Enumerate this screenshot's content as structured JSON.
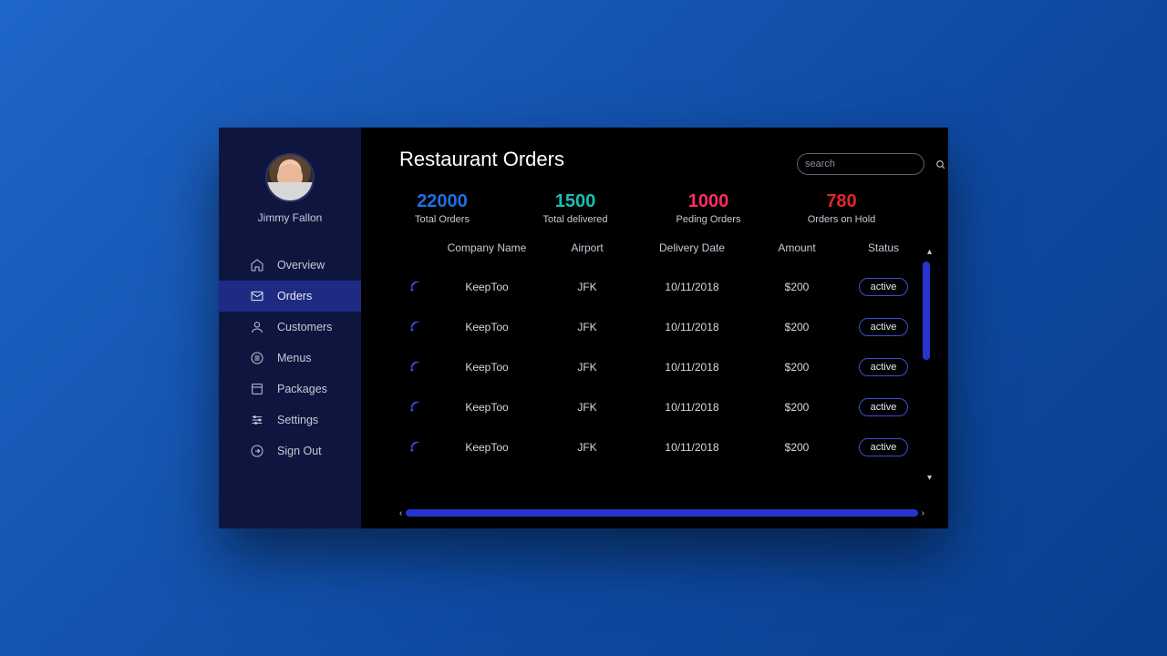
{
  "profile": {
    "name": "Jimmy Fallon"
  },
  "sidebar": {
    "items": [
      {
        "label": "Overview",
        "icon": "home-icon"
      },
      {
        "label": "Orders",
        "icon": "mail-icon"
      },
      {
        "label": "Customers",
        "icon": "user-icon"
      },
      {
        "label": "Menus",
        "icon": "menu-icon"
      },
      {
        "label": "Packages",
        "icon": "package-icon"
      },
      {
        "label": "Settings",
        "icon": "sliders-icon"
      },
      {
        "label": "Sign Out",
        "icon": "signout-icon"
      }
    ],
    "activeIndex": 1
  },
  "header": {
    "title": "Restaurant Orders"
  },
  "search": {
    "placeholder": "search"
  },
  "stats": [
    {
      "value": "22000",
      "label": "Total Orders",
      "color": "#1f6fe3"
    },
    {
      "value": "1500",
      "label": "Total delivered",
      "color": "#1abfb0"
    },
    {
      "value": "1000",
      "label": "Peding Orders",
      "color": "#ff2b66"
    },
    {
      "value": "780",
      "label": "Orders on Hold",
      "color": "#e02828"
    }
  ],
  "table": {
    "columns": [
      "Company Name",
      "Airport",
      "Delivery Date",
      "Amount",
      "Status"
    ],
    "rows": [
      {
        "company": "KeepToo",
        "airport": "JFK",
        "date": "10/11/2018",
        "amount": "$200",
        "status": "active"
      },
      {
        "company": "KeepToo",
        "airport": "JFK",
        "date": "10/11/2018",
        "amount": "$200",
        "status": "active"
      },
      {
        "company": "KeepToo",
        "airport": "JFK",
        "date": "10/11/2018",
        "amount": "$200",
        "status": "active"
      },
      {
        "company": "KeepToo",
        "airport": "JFK",
        "date": "10/11/2018",
        "amount": "$200",
        "status": "active"
      },
      {
        "company": "KeepToo",
        "airport": "JFK",
        "date": "10/11/2018",
        "amount": "$200",
        "status": "active"
      }
    ]
  }
}
